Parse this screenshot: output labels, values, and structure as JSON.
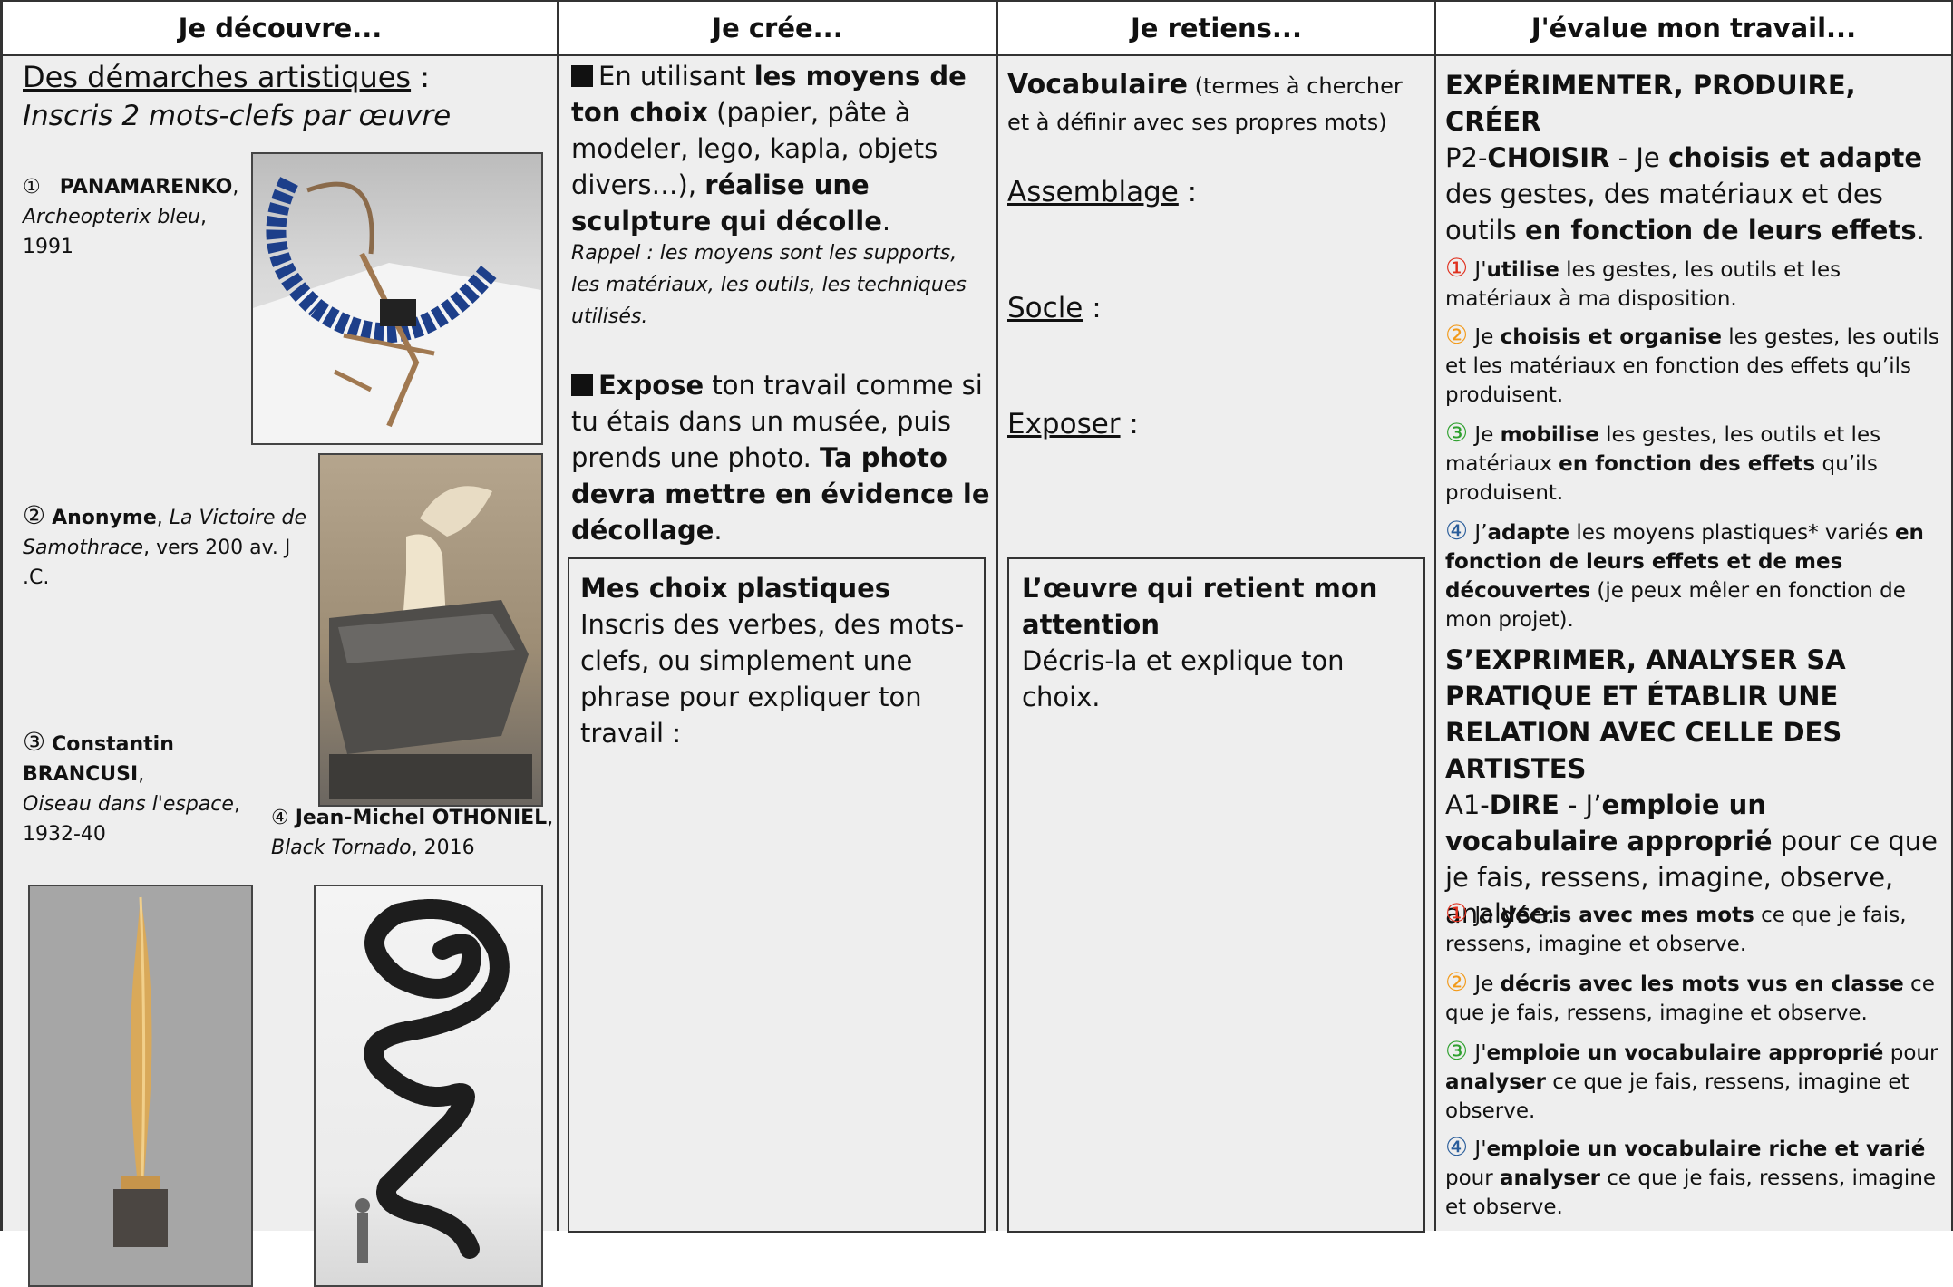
{
  "headers": [
    "Je découvre...",
    "Je crée...",
    "Je retiens...",
    "J'évalue mon travail..."
  ],
  "decouvre": {
    "title": "Des démarches artistiques",
    "title_suffix": " :",
    "instruction": "Inscris 2 mots-clefs par œuvre",
    "works": [
      {
        "num": "①",
        "artist": "PANAMARENKO",
        "title": "Archeopterix bleu",
        "date": "1991"
      },
      {
        "num": "②",
        "artist": "Anonyme",
        "title": "La Victoire de Samothrace",
        "date": "vers 200 av. J .C."
      },
      {
        "num": "③",
        "artist": "Constantin BRANCUSI",
        "title": "Oiseau dans l'espace",
        "date": "1932-40"
      },
      {
        "num": "④",
        "artist": "Jean-Michel OTHONIEL",
        "title": "Black Tornado",
        "date": "2016"
      }
    ]
  },
  "cree": {
    "p1_a": "En utilisant ",
    "p1_b": "les moyens de ton choix",
    "p1_c": " (papier, pâte à modeler, lego, kapla, objets divers…), ",
    "p1_d": "réalise une sculpture qui décolle",
    "p1_e": ".",
    "rappel": "Rappel : les moyens sont les supports, les matériaux, les outils, les techniques utilisés.",
    "p2_a": "Expose",
    "p2_b": " ton travail comme si tu étais dans un musée, puis prends une photo. ",
    "p2_c": "Ta photo devra mettre en évidence le décollage",
    "p2_d": ".",
    "box_title": "Mes choix plastiques",
    "box_text": "Inscris des verbes, des mots-clefs, ou simplement une phrase pour expliquer ton travail :"
  },
  "retiens": {
    "vocab_title": "Vocabulaire",
    "vocab_note": " (termes à chercher et à définir avec ses propres mots)",
    "terms": [
      "Assemblage",
      "Socle",
      "Exposer"
    ],
    "term_suffix": " :",
    "box_title": "L’œuvre qui retient mon attention",
    "box_text": "Décris-la et explique ton choix."
  },
  "evalue": {
    "s1_title": "EXPÉRIMENTER, PRODUIRE, CRÉER",
    "s1_code": "P2-",
    "s1_code_b": "CHOISIR",
    "s1_a": " - Je ",
    "s1_b": "choisis et adapte",
    "s1_c": " des gestes, des matériaux et des outils ",
    "s1_d": "en fonction de leurs effets",
    "s1_e": ".",
    "c1": {
      "n": "①",
      "a": " J'",
      "b": "utilise",
      "c": " les gestes, les outils et les matériaux à ma disposition."
    },
    "c2": {
      "n": "②",
      "a": " Je ",
      "b": "choisis et organise",
      "c": " les gestes, les outils et les matériaux en fonction des effets qu’ils produisent."
    },
    "c3": {
      "n": "③",
      "a": " Je ",
      "b": "mobilise",
      "c": " les gestes, les outils et les matériaux ",
      "d": "en fonction des effets",
      "e": " qu’ils produisent."
    },
    "c4": {
      "n": "④",
      "a": " J’",
      "b": "adapte",
      "c": " les moyens plastiques* variés ",
      "d": "en fonction de leurs effets et de mes découvertes",
      "e": " (je peux mêler en fonction de mon projet)."
    },
    "s2_title": "S’EXPRIMER, ANALYSER SA PRATIQUE ET ÉTABLIR UNE RELATION AVEC CELLE DES ARTISTES",
    "s2_code": "A1-",
    "s2_code_b": "DIRE",
    "s2_a": " - J’",
    "s2_b": "emploie un vocabulaire approprié",
    "s2_c": " pour ce que je fais, ressens, imagine, observe, analyse.",
    "d1": {
      "n": "①",
      "a": " Je ",
      "b": "décris avec mes mots",
      "c": " ce que je fais, ressens, imagine et observe."
    },
    "d2": {
      "n": "②",
      "a": " Je ",
      "b": "décris avec les mots vus en classe",
      "c": " ce que je fais, ressens, imagine et observe."
    },
    "d3": {
      "n": "③",
      "a": " J'",
      "b": "emploie un vocabulaire approprié",
      "c": " pour ",
      "d": "analyser",
      "e": " ce que je fais, ressens, imagine et observe."
    },
    "d4": {
      "n": "④",
      "a": " J'",
      "b": "emploie un vocabulaire riche et varié",
      "c": " pour ",
      "d": "analyser",
      "e": " ce que je fais, ressens, imagine et observe."
    }
  }
}
